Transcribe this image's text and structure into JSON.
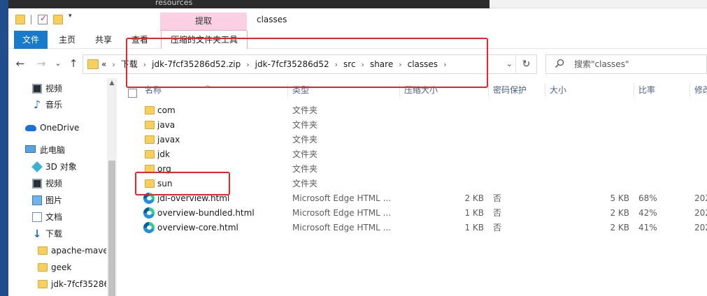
{
  "background": {
    "top_tab_text": "resources"
  },
  "titlebar": {
    "tools_tab": "提取",
    "title": "classes",
    "quick_access_dropdown": "▾"
  },
  "ribbon": {
    "tabs": [
      "文件",
      "主页",
      "共享",
      "查看"
    ],
    "context_tab": "压缩的文件夹工具"
  },
  "nav": {
    "back": "←",
    "forward": "→",
    "recent": "⌄",
    "up": "↑",
    "breadcrumbs": [
      "«",
      "下载",
      "jdk-7fcf35286d52.zip",
      "jdk-7fcf35286d52",
      "src",
      "share",
      "classes"
    ],
    "dropdown": "⌄",
    "refresh": "↻",
    "search_placeholder": "搜索\"classes\""
  },
  "sidebar": {
    "items": [
      {
        "label": "视频",
        "icon": "video-icon"
      },
      {
        "label": "音乐",
        "icon": "music-icon"
      },
      {
        "label": "OneDrive",
        "icon": "onedrive-icon"
      },
      {
        "label": "此电脑",
        "icon": "computer-icon"
      },
      {
        "label": "3D 对象",
        "icon": "3d-objects-icon"
      },
      {
        "label": "视频",
        "icon": "video-icon"
      },
      {
        "label": "图片",
        "icon": "pictures-icon"
      },
      {
        "label": "文档",
        "icon": "documents-icon"
      },
      {
        "label": "下载",
        "icon": "download-icon"
      },
      {
        "label": "apache-mave",
        "icon": "folder-icon"
      },
      {
        "label": "geek",
        "icon": "folder-icon"
      },
      {
        "label": "jdk-7fcf35286",
        "icon": "folder-icon"
      }
    ]
  },
  "columns": [
    "名称",
    "类型",
    "压缩大小",
    "密码保护",
    "大小",
    "比率",
    "修改"
  ],
  "files": [
    {
      "name": "com",
      "type": "文件夹",
      "packed": "",
      "protected": "",
      "size": "",
      "ratio": "",
      "modified": "",
      "kind": "folder"
    },
    {
      "name": "java",
      "type": "文件夹",
      "packed": "",
      "protected": "",
      "size": "",
      "ratio": "",
      "modified": "",
      "kind": "folder"
    },
    {
      "name": "javax",
      "type": "文件夹",
      "packed": "",
      "protected": "",
      "size": "",
      "ratio": "",
      "modified": "",
      "kind": "folder"
    },
    {
      "name": "jdk",
      "type": "文件夹",
      "packed": "",
      "protected": "",
      "size": "",
      "ratio": "",
      "modified": "",
      "kind": "folder"
    },
    {
      "name": "org",
      "type": "文件夹",
      "packed": "",
      "protected": "",
      "size": "",
      "ratio": "",
      "modified": "",
      "kind": "folder"
    },
    {
      "name": "sun",
      "type": "文件夹",
      "packed": "",
      "protected": "",
      "size": "",
      "ratio": "",
      "modified": "",
      "kind": "folder"
    },
    {
      "name": "jdi-overview.html",
      "type": "Microsoft Edge HTML ...",
      "packed": "2 KB",
      "protected": "否",
      "size": "5 KB",
      "ratio": "68%",
      "modified": "202",
      "kind": "edge"
    },
    {
      "name": "overview-bundled.html",
      "type": "Microsoft Edge HTML ...",
      "packed": "1 KB",
      "protected": "否",
      "size": "2 KB",
      "ratio": "42%",
      "modified": "202",
      "kind": "edge"
    },
    {
      "name": "overview-core.html",
      "type": "Microsoft Edge HTML ...",
      "packed": "1 KB",
      "protected": "否",
      "size": "2 KB",
      "ratio": "41%",
      "modified": "202",
      "kind": "edge"
    }
  ],
  "colors": {
    "file_tab": "#1979ca",
    "tools_tab": "#fbd0e3",
    "highlight_red": "#e5262b",
    "header_text": "#4d6082"
  }
}
